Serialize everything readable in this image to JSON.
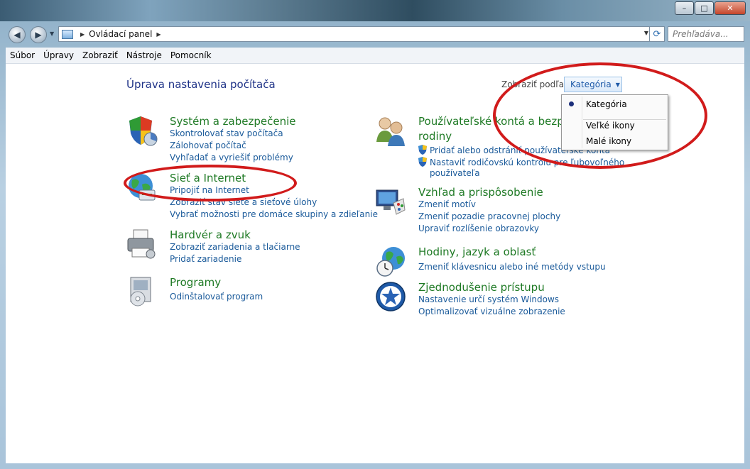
{
  "window": {
    "controls": [
      "–",
      "□",
      "✕"
    ]
  },
  "address": {
    "breadcrumb": "Ovládací panel",
    "search_placeholder": "Prehľadáva..."
  },
  "menubar": [
    "Súbor",
    "Úpravy",
    "Zobraziť",
    "Nástroje",
    "Pomocník"
  ],
  "main": {
    "title": "Úprava nastavenia počítača",
    "view_by_label": "Zobraziť podľa:",
    "view_by_value": "Kategória",
    "view_menu": {
      "options": [
        "Kategória",
        "Veľké ikony",
        "Malé ikony"
      ],
      "selected": "Kategória"
    }
  },
  "categories_left": [
    {
      "title": "Systém a zabezpečenie",
      "links": [
        "Skontrolovať stav počítača",
        "Zálohovať počítač",
        "Vyhľadať a vyriešiť problémy"
      ]
    },
    {
      "title": "Sieť a Internet",
      "links": [
        "Pripojiť na Internet",
        "Zobraziť stav siete a sieťové úlohy",
        "Vybrať možnosti pre domáce skupiny a zdieľanie"
      ]
    },
    {
      "title": "Hardvér a zvuk",
      "links": [
        "Zobraziť zariadenia a tlačiarne",
        "Pridať zariadenie"
      ]
    },
    {
      "title": "Programy",
      "links": [
        "Odinštalovať program"
      ]
    }
  ],
  "categories_right": [
    {
      "title_line1": "Používateľské kontá a bezpečnosť",
      "title_line2": "rodiny",
      "links": [
        "Pridať alebo odstrániť používateľské kontá",
        "Nastaviť rodičovskú kontrolu pre ľubovoľného",
        "používateľa"
      ]
    },
    {
      "title": "Vzhľad a prispôsobenie",
      "links": [
        "Zmeniť motív",
        "Zmeniť pozadie pracovnej plochy",
        "Upraviť rozlíšenie obrazovky"
      ]
    },
    {
      "title": "Hodiny, jazyk a oblasť",
      "links": [
        "Zmeniť klávesnicu alebo iné metódy vstupu"
      ]
    },
    {
      "title": "Zjednodušenie prístupu",
      "links": [
        "Nastavenie určí systém Windows",
        "Optimalizovať vizuálne zobrazenie"
      ]
    }
  ]
}
